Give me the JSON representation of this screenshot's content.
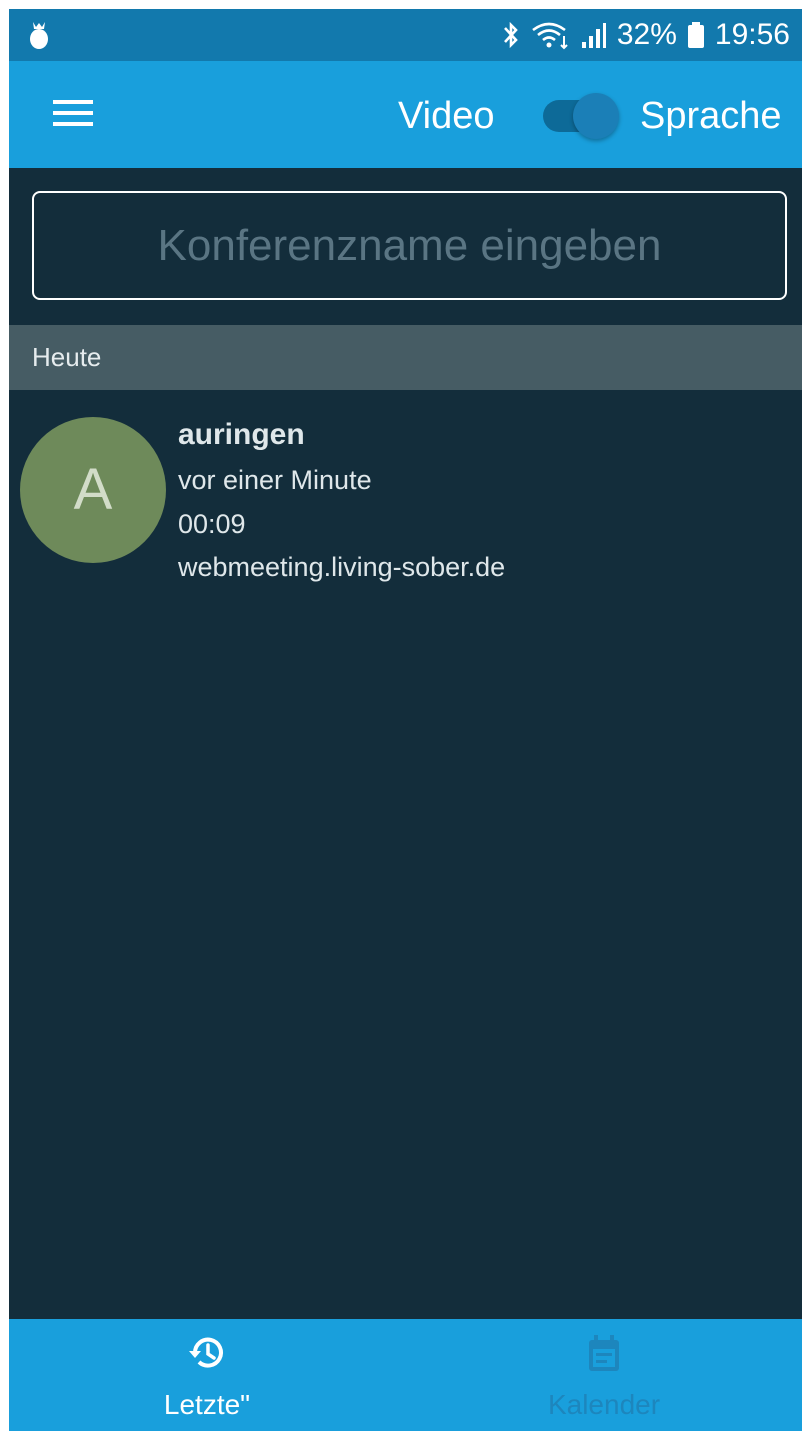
{
  "status_bar": {
    "left_icon": "notification-app-icon",
    "bluetooth_icon": "bluetooth-icon",
    "wifi_icon": "wifi-icon",
    "signal_icon": "signal-icon",
    "battery": "32%",
    "battery_icon": "battery-icon",
    "time": "19:56"
  },
  "app_bar": {
    "menu_icon": "hamburger-menu-icon",
    "video_label": "Video",
    "sprache_label": "Sprache",
    "toggle_state": "on"
  },
  "search": {
    "placeholder": "Konferenzname eingeben",
    "value": ""
  },
  "section": {
    "title": "Heute"
  },
  "recent": [
    {
      "avatar_letter": "A",
      "avatar_color": "#6e8a5a",
      "name": "auringen",
      "time_ago": "vor einer Minute",
      "duration": "00:09",
      "server": "webmeeting.living-sober.de"
    }
  ],
  "bottom_nav": {
    "items": [
      {
        "label": "Letzte\"",
        "icon": "history-icon",
        "active": true
      },
      {
        "label": "Kalender",
        "icon": "calendar-icon",
        "active": false
      }
    ]
  },
  "colors": {
    "background": "#132d3b",
    "app_bar": "#199fdc",
    "status_bar": "#1279ad",
    "section_header": "#465c64"
  }
}
